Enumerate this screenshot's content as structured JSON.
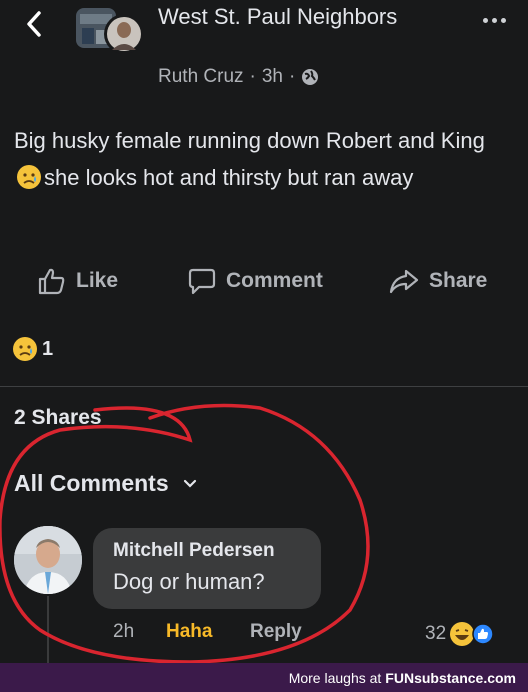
{
  "header": {
    "group_name": "West St. Paul Neighbors",
    "author": "Ruth Cruz",
    "time": "3h",
    "separator": "·"
  },
  "post": {
    "text_part1": "Big husky female running down Robert and King",
    "text_part2": "she looks hot and thirsty but ran away"
  },
  "actions": {
    "like": "Like",
    "comment": "Comment",
    "share": "Share"
  },
  "reactions": {
    "count": "1"
  },
  "shares_label": "2 Shares",
  "comments_filter": "All Comments",
  "comment": {
    "author": "Mitchell Pedersen",
    "text": "Dog or human?",
    "time": "2h",
    "reaction_label": "Haha",
    "reply_label": "Reply",
    "reaction_count": "32"
  },
  "footer": {
    "text": "More laughs at",
    "brand": "FUNsubstance.com"
  },
  "colors": {
    "background": "#18191a",
    "bubble": "#3a3b3c",
    "haha": "#f7b928",
    "annotation": "#d9252f"
  }
}
